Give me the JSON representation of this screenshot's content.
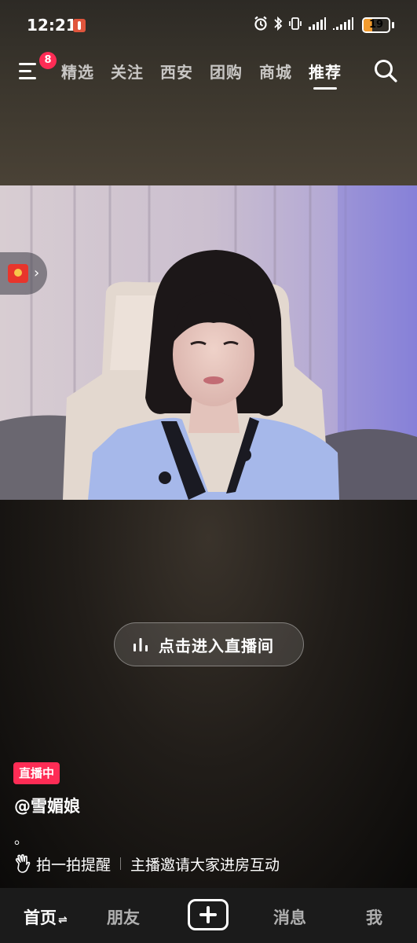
{
  "status_bar": {
    "time": "12:21",
    "battery_level": "19",
    "icons": [
      "alarm-icon",
      "bluetooth-icon",
      "vibrate-icon",
      "signal-icon",
      "signal-icon"
    ]
  },
  "top_nav": {
    "menu_badge": "8",
    "tabs": [
      "精选",
      "关注",
      "西安",
      "团购",
      "商城",
      "推荐"
    ],
    "active_tab": "推荐"
  },
  "video": {
    "enter_live_label": "点击进入直播间"
  },
  "info": {
    "live_badge": "直播中",
    "username": "@雪媚娘",
    "caption": "。",
    "action_label": "拍一拍提醒",
    "action_desc": "主播邀请大家进房互动"
  },
  "bottom_nav": {
    "home": "首页",
    "friends": "朋友",
    "messages": "消息",
    "me": "我"
  },
  "colors": {
    "accent": "#fe2c55",
    "battery": "#f29b2e",
    "nav_bg": "#1b1b1b"
  }
}
